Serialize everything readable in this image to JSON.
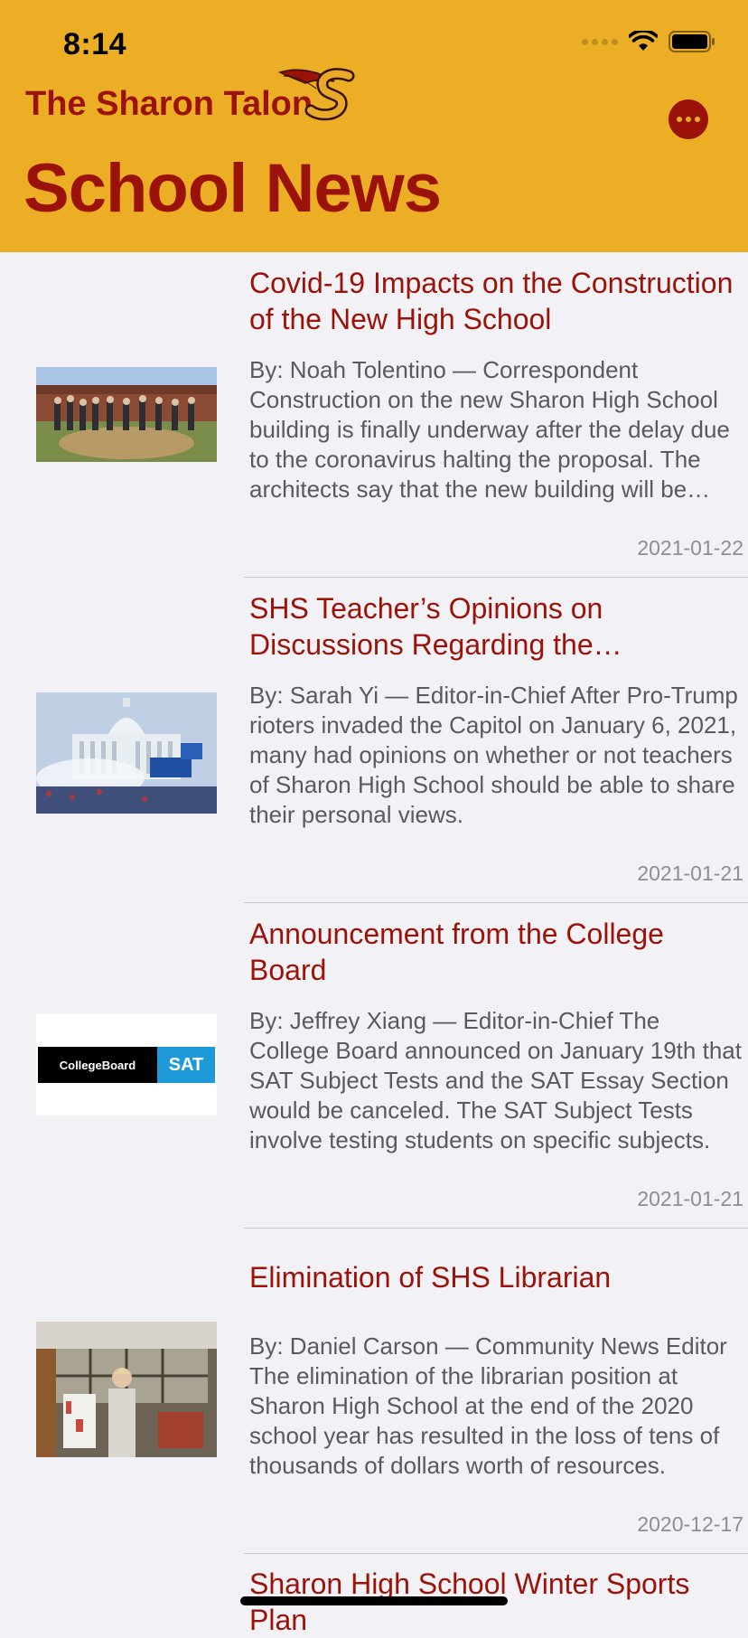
{
  "status_bar": {
    "time": "8:14"
  },
  "header": {
    "brand_title": "The Sharon Talon",
    "logo_icon": "talon-s-logo",
    "page_title": "School News",
    "more_icon": "ellipsis-circle-icon"
  },
  "colors": {
    "header_bg": "#ECAE24",
    "accent": "#9B1208",
    "list_bg": "#F2F1F6",
    "excerpt": "#5A5A5E",
    "date": "#8E8E93"
  },
  "articles": [
    {
      "title": "Covid-19 Impacts on the Construction of the New High School",
      "excerpt": "By: Noah Tolentino — Correspondent Construction on the new Sharon High School building is finally underway after the delay due to the coronavirus halting the proposal. The architects say that the new building will be ready soon.",
      "date": "2021-01-22"
    },
    {
      "title": "SHS Teacher’s Opinions on Discussions Regarding the Insurrection",
      "excerpt": "By: Sarah Yi — Editor-in-Chief After Pro-Trump rioters invaded the Capitol on January 6, 2021, many had opinions on whether or not teachers of Sharon High School should be able to share their personal views.",
      "date": "2021-01-21"
    },
    {
      "title": "Announcement from the College Board",
      "excerpt": "By: Jeffrey Xiang — Editor-in-Chief The College Board announced on January 19th that SAT Subject Tests and the SAT Essay Section would be canceled. The SAT Subject Tests involve testing students on specific subjects.",
      "date": "2021-01-21",
      "thumb_text_left": "CollegeBoard",
      "thumb_text_right": "SAT"
    },
    {
      "title": "Elimination of SHS Librarian",
      "excerpt": "By: Daniel Carson — Community News Editor The elimination of the librarian position at Sharon High School at the end of the 2020 school year has resulted in the loss of tens of thousands of dollars worth of resources.",
      "date": "2020-12-17"
    }
  ],
  "partial_article": {
    "title": "Sharon High School Winter Sports Plan"
  }
}
